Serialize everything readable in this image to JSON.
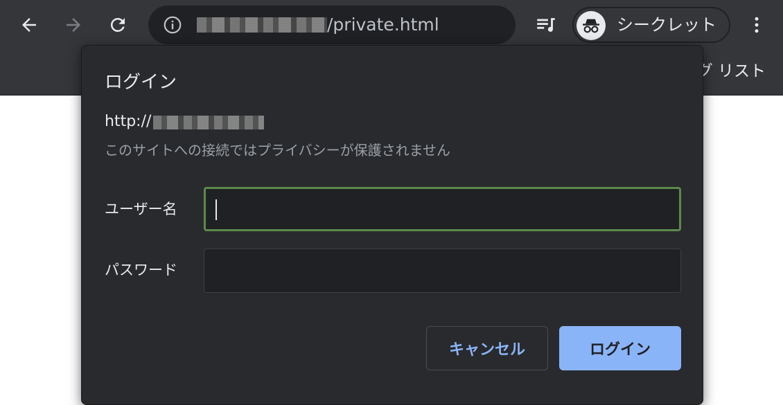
{
  "browser": {
    "url_path": "/private.html",
    "incognito_label": "シークレット",
    "bookmarks_bar_text": "グ リスト",
    "icons": {
      "back": "back-arrow-icon",
      "forward": "forward-arrow-icon",
      "reload": "reload-icon",
      "site_info": "info-icon",
      "bookmark": "star-icon",
      "reading_list": "media-queue-icon",
      "incognito": "incognito-icon",
      "menu": "more-vertical-icon"
    }
  },
  "dialog": {
    "title": "ログイン",
    "origin_prefix": "http://",
    "privacy_note": "このサイトへの接続ではプライバシーが保護されません",
    "username_label": "ユーザー名",
    "username_value": "",
    "password_label": "パスワード",
    "password_value": "",
    "cancel_label": "キャンセル",
    "login_label": "ログイン"
  },
  "colors": {
    "toolbar_bg": "#35363a",
    "dialog_bg": "#292a2d",
    "accent_blue": "#8ab4f8",
    "focus_green": "#5b8a4a"
  }
}
